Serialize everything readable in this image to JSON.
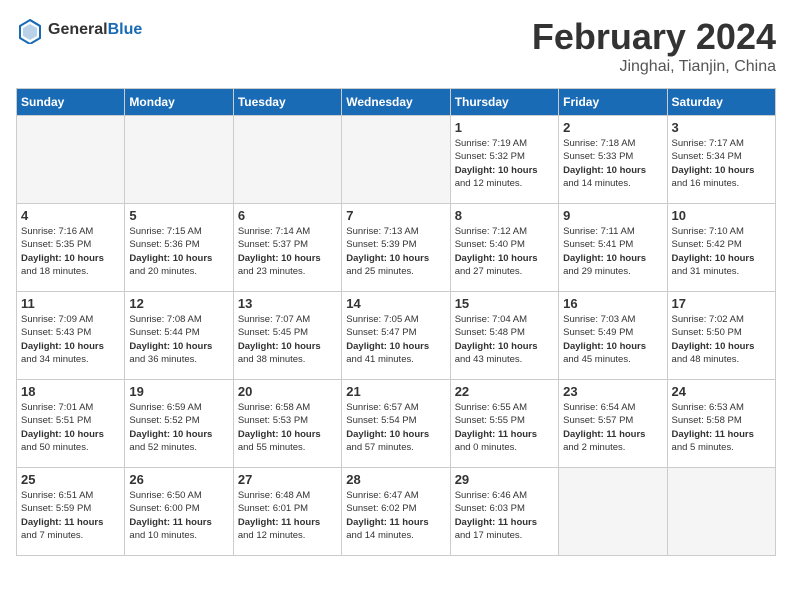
{
  "header": {
    "logo_general": "General",
    "logo_blue": "Blue",
    "title": "February 2024",
    "location": "Jinghai, Tianjin, China"
  },
  "days_of_week": [
    "Sunday",
    "Monday",
    "Tuesday",
    "Wednesday",
    "Thursday",
    "Friday",
    "Saturday"
  ],
  "weeks": [
    [
      {
        "day": "",
        "info": ""
      },
      {
        "day": "",
        "info": ""
      },
      {
        "day": "",
        "info": ""
      },
      {
        "day": "",
        "info": ""
      },
      {
        "day": "1",
        "info": "Sunrise: 7:19 AM\nSunset: 5:32 PM\nDaylight: 10 hours\nand 12 minutes."
      },
      {
        "day": "2",
        "info": "Sunrise: 7:18 AM\nSunset: 5:33 PM\nDaylight: 10 hours\nand 14 minutes."
      },
      {
        "day": "3",
        "info": "Sunrise: 7:17 AM\nSunset: 5:34 PM\nDaylight: 10 hours\nand 16 minutes."
      }
    ],
    [
      {
        "day": "4",
        "info": "Sunrise: 7:16 AM\nSunset: 5:35 PM\nDaylight: 10 hours\nand 18 minutes."
      },
      {
        "day": "5",
        "info": "Sunrise: 7:15 AM\nSunset: 5:36 PM\nDaylight: 10 hours\nand 20 minutes."
      },
      {
        "day": "6",
        "info": "Sunrise: 7:14 AM\nSunset: 5:37 PM\nDaylight: 10 hours\nand 23 minutes."
      },
      {
        "day": "7",
        "info": "Sunrise: 7:13 AM\nSunset: 5:39 PM\nDaylight: 10 hours\nand 25 minutes."
      },
      {
        "day": "8",
        "info": "Sunrise: 7:12 AM\nSunset: 5:40 PM\nDaylight: 10 hours\nand 27 minutes."
      },
      {
        "day": "9",
        "info": "Sunrise: 7:11 AM\nSunset: 5:41 PM\nDaylight: 10 hours\nand 29 minutes."
      },
      {
        "day": "10",
        "info": "Sunrise: 7:10 AM\nSunset: 5:42 PM\nDaylight: 10 hours\nand 31 minutes."
      }
    ],
    [
      {
        "day": "11",
        "info": "Sunrise: 7:09 AM\nSunset: 5:43 PM\nDaylight: 10 hours\nand 34 minutes."
      },
      {
        "day": "12",
        "info": "Sunrise: 7:08 AM\nSunset: 5:44 PM\nDaylight: 10 hours\nand 36 minutes."
      },
      {
        "day": "13",
        "info": "Sunrise: 7:07 AM\nSunset: 5:45 PM\nDaylight: 10 hours\nand 38 minutes."
      },
      {
        "day": "14",
        "info": "Sunrise: 7:05 AM\nSunset: 5:47 PM\nDaylight: 10 hours\nand 41 minutes."
      },
      {
        "day": "15",
        "info": "Sunrise: 7:04 AM\nSunset: 5:48 PM\nDaylight: 10 hours\nand 43 minutes."
      },
      {
        "day": "16",
        "info": "Sunrise: 7:03 AM\nSunset: 5:49 PM\nDaylight: 10 hours\nand 45 minutes."
      },
      {
        "day": "17",
        "info": "Sunrise: 7:02 AM\nSunset: 5:50 PM\nDaylight: 10 hours\nand 48 minutes."
      }
    ],
    [
      {
        "day": "18",
        "info": "Sunrise: 7:01 AM\nSunset: 5:51 PM\nDaylight: 10 hours\nand 50 minutes."
      },
      {
        "day": "19",
        "info": "Sunrise: 6:59 AM\nSunset: 5:52 PM\nDaylight: 10 hours\nand 52 minutes."
      },
      {
        "day": "20",
        "info": "Sunrise: 6:58 AM\nSunset: 5:53 PM\nDaylight: 10 hours\nand 55 minutes."
      },
      {
        "day": "21",
        "info": "Sunrise: 6:57 AM\nSunset: 5:54 PM\nDaylight: 10 hours\nand 57 minutes."
      },
      {
        "day": "22",
        "info": "Sunrise: 6:55 AM\nSunset: 5:55 PM\nDaylight: 11 hours\nand 0 minutes."
      },
      {
        "day": "23",
        "info": "Sunrise: 6:54 AM\nSunset: 5:57 PM\nDaylight: 11 hours\nand 2 minutes."
      },
      {
        "day": "24",
        "info": "Sunrise: 6:53 AM\nSunset: 5:58 PM\nDaylight: 11 hours\nand 5 minutes."
      }
    ],
    [
      {
        "day": "25",
        "info": "Sunrise: 6:51 AM\nSunset: 5:59 PM\nDaylight: 11 hours\nand 7 minutes."
      },
      {
        "day": "26",
        "info": "Sunrise: 6:50 AM\nSunset: 6:00 PM\nDaylight: 11 hours\nand 10 minutes."
      },
      {
        "day": "27",
        "info": "Sunrise: 6:48 AM\nSunset: 6:01 PM\nDaylight: 11 hours\nand 12 minutes."
      },
      {
        "day": "28",
        "info": "Sunrise: 6:47 AM\nSunset: 6:02 PM\nDaylight: 11 hours\nand 14 minutes."
      },
      {
        "day": "29",
        "info": "Sunrise: 6:46 AM\nSunset: 6:03 PM\nDaylight: 11 hours\nand 17 minutes."
      },
      {
        "day": "",
        "info": ""
      },
      {
        "day": "",
        "info": ""
      }
    ]
  ]
}
